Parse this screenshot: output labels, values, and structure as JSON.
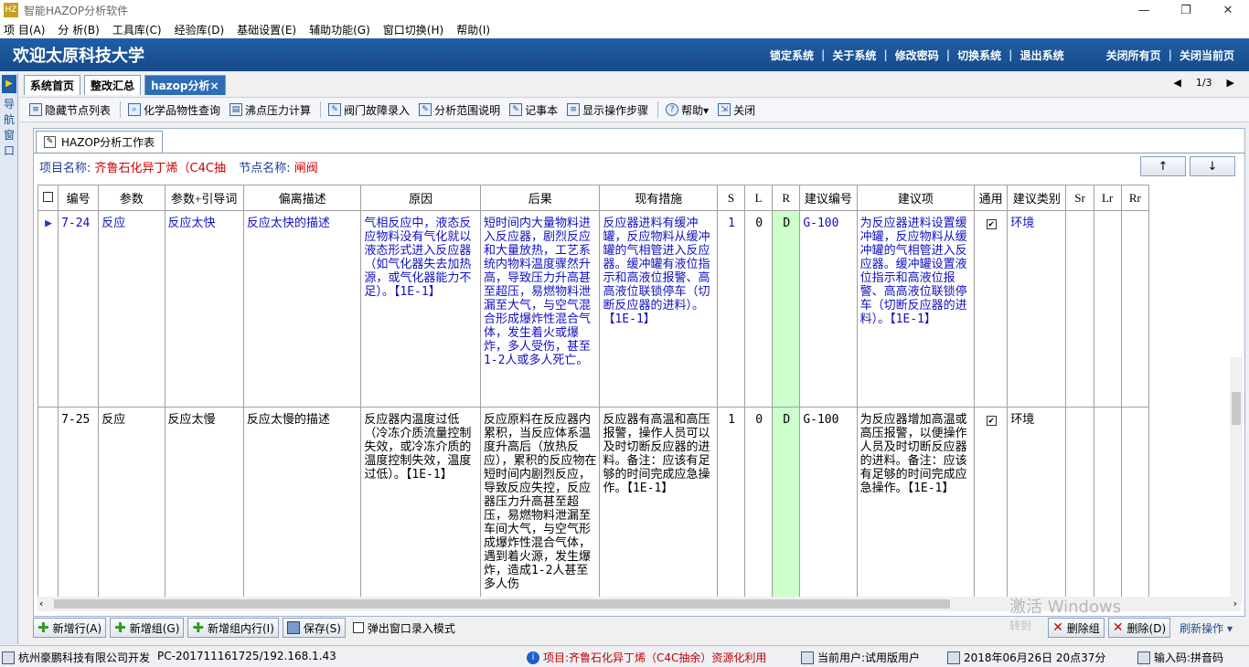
{
  "window": {
    "title": "智能HAZOP分析软件",
    "app_icon": "HZ"
  },
  "menu": [
    "项 目(A)",
    "分 析(B)",
    "工具库(C)",
    "经验库(D)",
    "基础设置(E)",
    "辅助功能(G)",
    "窗口切换(H)",
    "帮助(I)"
  ],
  "banner": {
    "welcome": "欢迎太原科技大学",
    "links": [
      "锁定系统",
      "关于系统",
      "修改密码",
      "切换系统",
      "退出系统"
    ],
    "right_links": [
      "关闭所有页",
      "关闭当前页"
    ]
  },
  "nav": {
    "label": "导航窗口"
  },
  "tabs": [
    {
      "label": "系统首页"
    },
    {
      "label": "整改汇总"
    },
    {
      "label": "hazop分析×"
    }
  ],
  "pager": {
    "text": "1/3"
  },
  "toolbar": [
    "隐藏节点列表",
    "化学品物性查询",
    "沸点压力计算",
    "阀门故障录入",
    "分析范围说明",
    "记事本",
    "显示操作步骤",
    "帮助▾",
    "关闭"
  ],
  "panel": {
    "tab": "HAZOP分析工作表",
    "project_label": "项目名称:",
    "project_value": "齐鲁石化异丁烯（C4C抽",
    "node_label": "节点名称:",
    "node_value": "闸阀",
    "up": "↑",
    "down": "↓"
  },
  "grid": {
    "headers": [
      "编号",
      "参数",
      "参数+引导词",
      "偏离描述",
      "原因",
      "后果",
      "现有措施",
      "S",
      "L",
      "R",
      "建议编号",
      "建议项",
      "通用",
      "建议类别",
      "Sr",
      "Lr",
      "Rr"
    ],
    "rows": [
      {
        "id": "7-24",
        "param": "反应",
        "guide": "反应太快",
        "deviation": "反应太快的描述",
        "cause": "气相反应中，液态反应物料没有气化就以液态形式进入反应器（如气化器失去加热源，或气化器能力不足）。【1E-1】",
        "consequence": "短时间内大量物料进入反应器，剧烈反应和大量放热，工艺系统内物料温度骤然升高，导致压力升高甚至超压，易燃物料泄漏至大气，与空气混合形成爆炸性混合气体，发生着火或爆炸，多人受伤，甚至1-2人或多人死亡。",
        "measures": "反应器进料有缓冲罐，反应物料从缓冲罐的气相管进入反应器。缓冲罐有液位指示和高液位报警、高高液位联锁停车（切断反应器的进料）。【1E-1】",
        "s": "1",
        "l": "0",
        "r": "D",
        "sugg_id": "G-100",
        "suggestion": "为反应器进料设置缓冲罐，反应物料从缓冲罐的气相管进入反应器。缓冲罐设置液位指示和高液位报警、高高液位联锁停车（切断反应器的进料）。【1E-1】",
        "general": "✔",
        "category": "环境",
        "sr": "",
        "lr": "",
        "rr": ""
      },
      {
        "id": "7-25",
        "param": "反应",
        "guide": "反应太慢",
        "deviation": "反应太慢的描述",
        "cause": "反应器内温度过低（冷冻介质流量控制失效，或冷冻介质的温度控制失效，温度过低）。【1E-1】",
        "consequence": "反应原料在反应器内累积，当反应体系温度升高后（放热反应），累积的反应物在短时间内剧烈反应，导致反应失控，反应器压力升高甚至超压，易燃物料泄漏至车间大气，与空气形成爆炸性混合气体，遇到着火源，发生爆炸，造成1-2人甚至多人伤",
        "measures": "反应器有高温和高压报警，操作人员可以及时切断反应器的进料。备注：应该有足够的时间完成应急操作。【1E-1】",
        "s": "1",
        "l": "0",
        "r": "D",
        "sugg_id": "G-100",
        "suggestion": "为反应器增加高温或高压报警，以便操作人员及时切断反应器的进料。备注：应该有足够的时间完成应急操作。【1E-1】",
        "general": "✔",
        "category": "环境",
        "sr": "",
        "lr": "",
        "rr": ""
      }
    ]
  },
  "bottom": {
    "add_row": "新增行(A)",
    "add_group": "新增组(G)",
    "add_group_row": "新增组内行(I)",
    "save": "保存(S)",
    "popup_mode": "弹出窗口录入模式",
    "delete_group": "删除组",
    "delete": "删除(D)",
    "refresh": "刷新操作 ▾"
  },
  "watermark": {
    "line1": "激活 Windows",
    "line2": "转到"
  },
  "status": {
    "company": "杭州豪鹏科技有限公司开发",
    "host": "PC-201711161725/192.168.1.43",
    "project": "项目:齐鲁石化异丁烯（C4C抽余）资源化利用",
    "user": "当前用户:试用版用户",
    "datetime": "2018年06月26日 20点37分",
    "ime": "输入码:拼音码"
  }
}
